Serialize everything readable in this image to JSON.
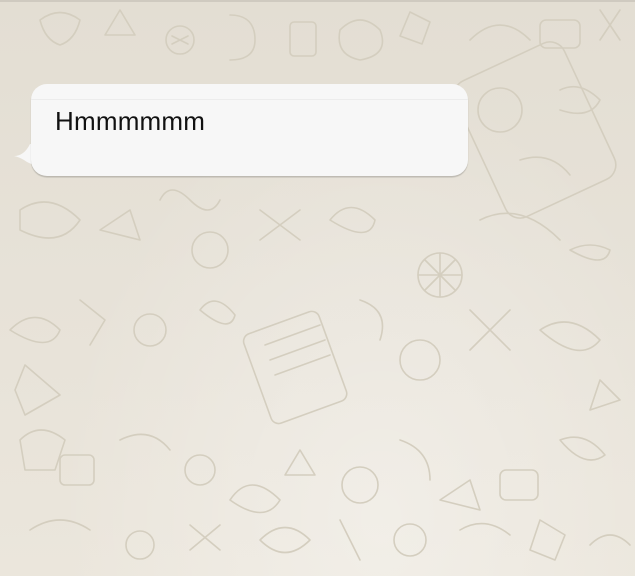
{
  "chat": {
    "background_color": "#e6e1d6",
    "messages": [
      {
        "direction": "incoming",
        "text": "Hmmmmmm",
        "bubble_color": "#f7f7f7"
      }
    ]
  }
}
